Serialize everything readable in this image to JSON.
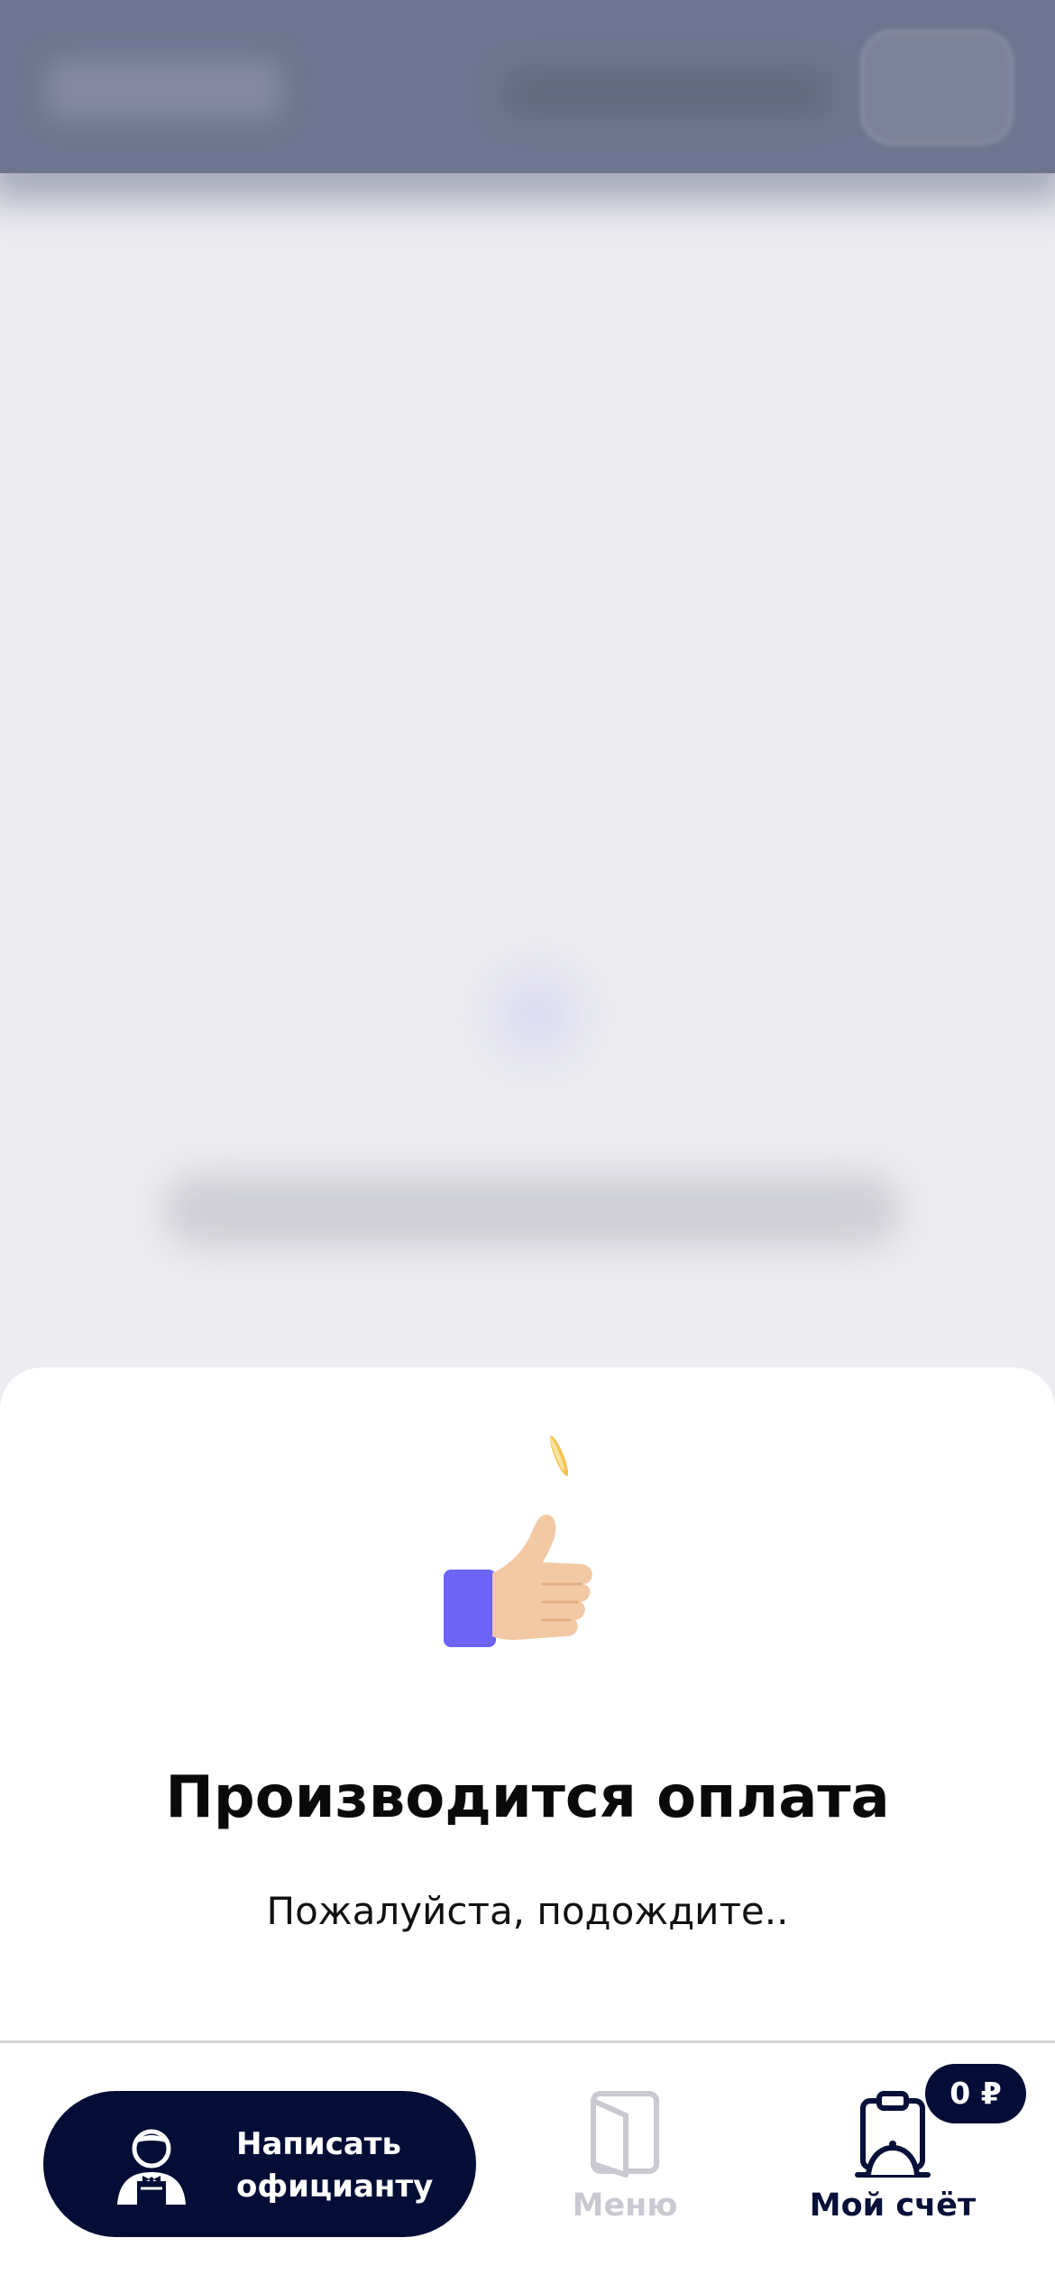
{
  "colors": {
    "background": "#ececf1",
    "header_blur": "#6d7590",
    "sheet": "#ffffff",
    "primary_dark": "#040d35",
    "inactive_nav": "#c9c9d2",
    "thumb_sleeve": "#6d63f5",
    "thumb_skin": "#f2c9a4",
    "coin": "#f4c453"
  },
  "payment_sheet": {
    "illustration_icon": "thumbs-up-coin-icon",
    "title": "Производится оплата",
    "subtitle": "Пожалуйста, подождите.."
  },
  "bottom_nav": {
    "waiter_button": {
      "icon": "waiter-icon",
      "label": "Написать официанту"
    },
    "menu": {
      "icon": "menu-book-icon",
      "label": "Меню"
    },
    "bill": {
      "icon": "cloche-clipboard-icon",
      "label": "Мой счёт",
      "badge": "0 ₽"
    }
  }
}
